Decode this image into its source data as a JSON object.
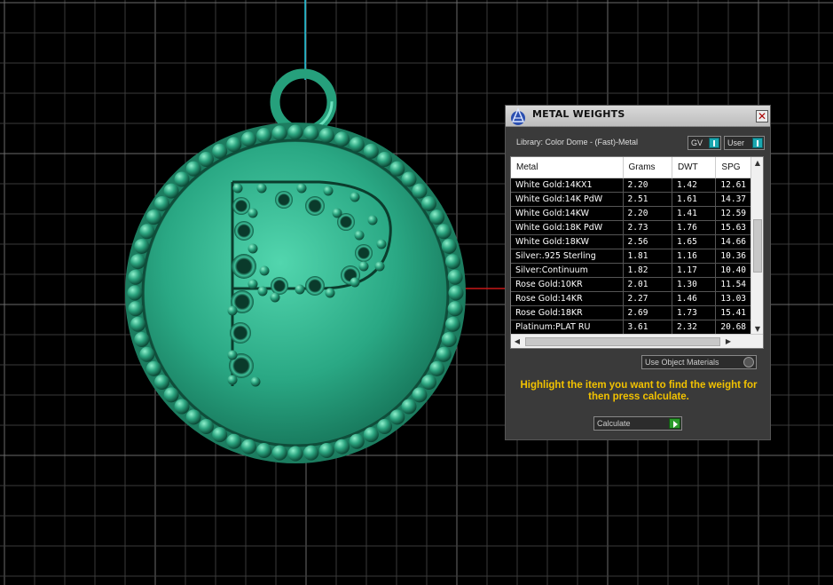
{
  "panel": {
    "title": "METAL WEIGHTS",
    "close_glyph": "✕",
    "library_label": "Library: Color Dome - (Fast)-Metal",
    "toggle_gv": "GV",
    "toggle_user": "User",
    "use_object_materials": "Use Object Materials",
    "hint": "Highlight the item you want to find the weight for then press calculate.",
    "calculate": "Calculate"
  },
  "table": {
    "columns": [
      "Metal",
      "Grams",
      "DWT",
      "SPG"
    ],
    "rows": [
      [
        "White Gold:14KX1",
        "2.20",
        "1.42",
        "12.61"
      ],
      [
        "White Gold:14K PdW",
        "2.51",
        "1.61",
        "14.37"
      ],
      [
        "White Gold:14KW",
        "2.20",
        "1.41",
        "12.59"
      ],
      [
        "White Gold:18K PdW",
        "2.73",
        "1.76",
        "15.63"
      ],
      [
        "White Gold:18KW",
        "2.56",
        "1.65",
        "14.66"
      ],
      [
        "Silver:.925 Sterling",
        "1.81",
        "1.16",
        "10.36"
      ],
      [
        "Silver:Continuum",
        "1.82",
        "1.17",
        "10.40"
      ],
      [
        "Rose Gold:10KR",
        "2.01",
        "1.30",
        "11.54"
      ],
      [
        "Rose Gold:14KR",
        "2.27",
        "1.46",
        "13.03"
      ],
      [
        "Rose Gold:18KR",
        "2.69",
        "1.73",
        "15.41"
      ],
      [
        "Platinum:PLAT RU",
        "3.61",
        "2.32",
        "20.68"
      ]
    ]
  },
  "colors": {
    "hint": "#f2c200",
    "pendant": "#2fae88",
    "toggle_knob": "#1aa7b0",
    "go_button": "#2a9a2a",
    "grid": "#4a4a4a"
  },
  "icons": {
    "logo": "rhino-logo-icon",
    "close": "close-icon",
    "toggle": "toggle-icon",
    "radio": "radio-icon",
    "go": "play-arrow-icon"
  }
}
